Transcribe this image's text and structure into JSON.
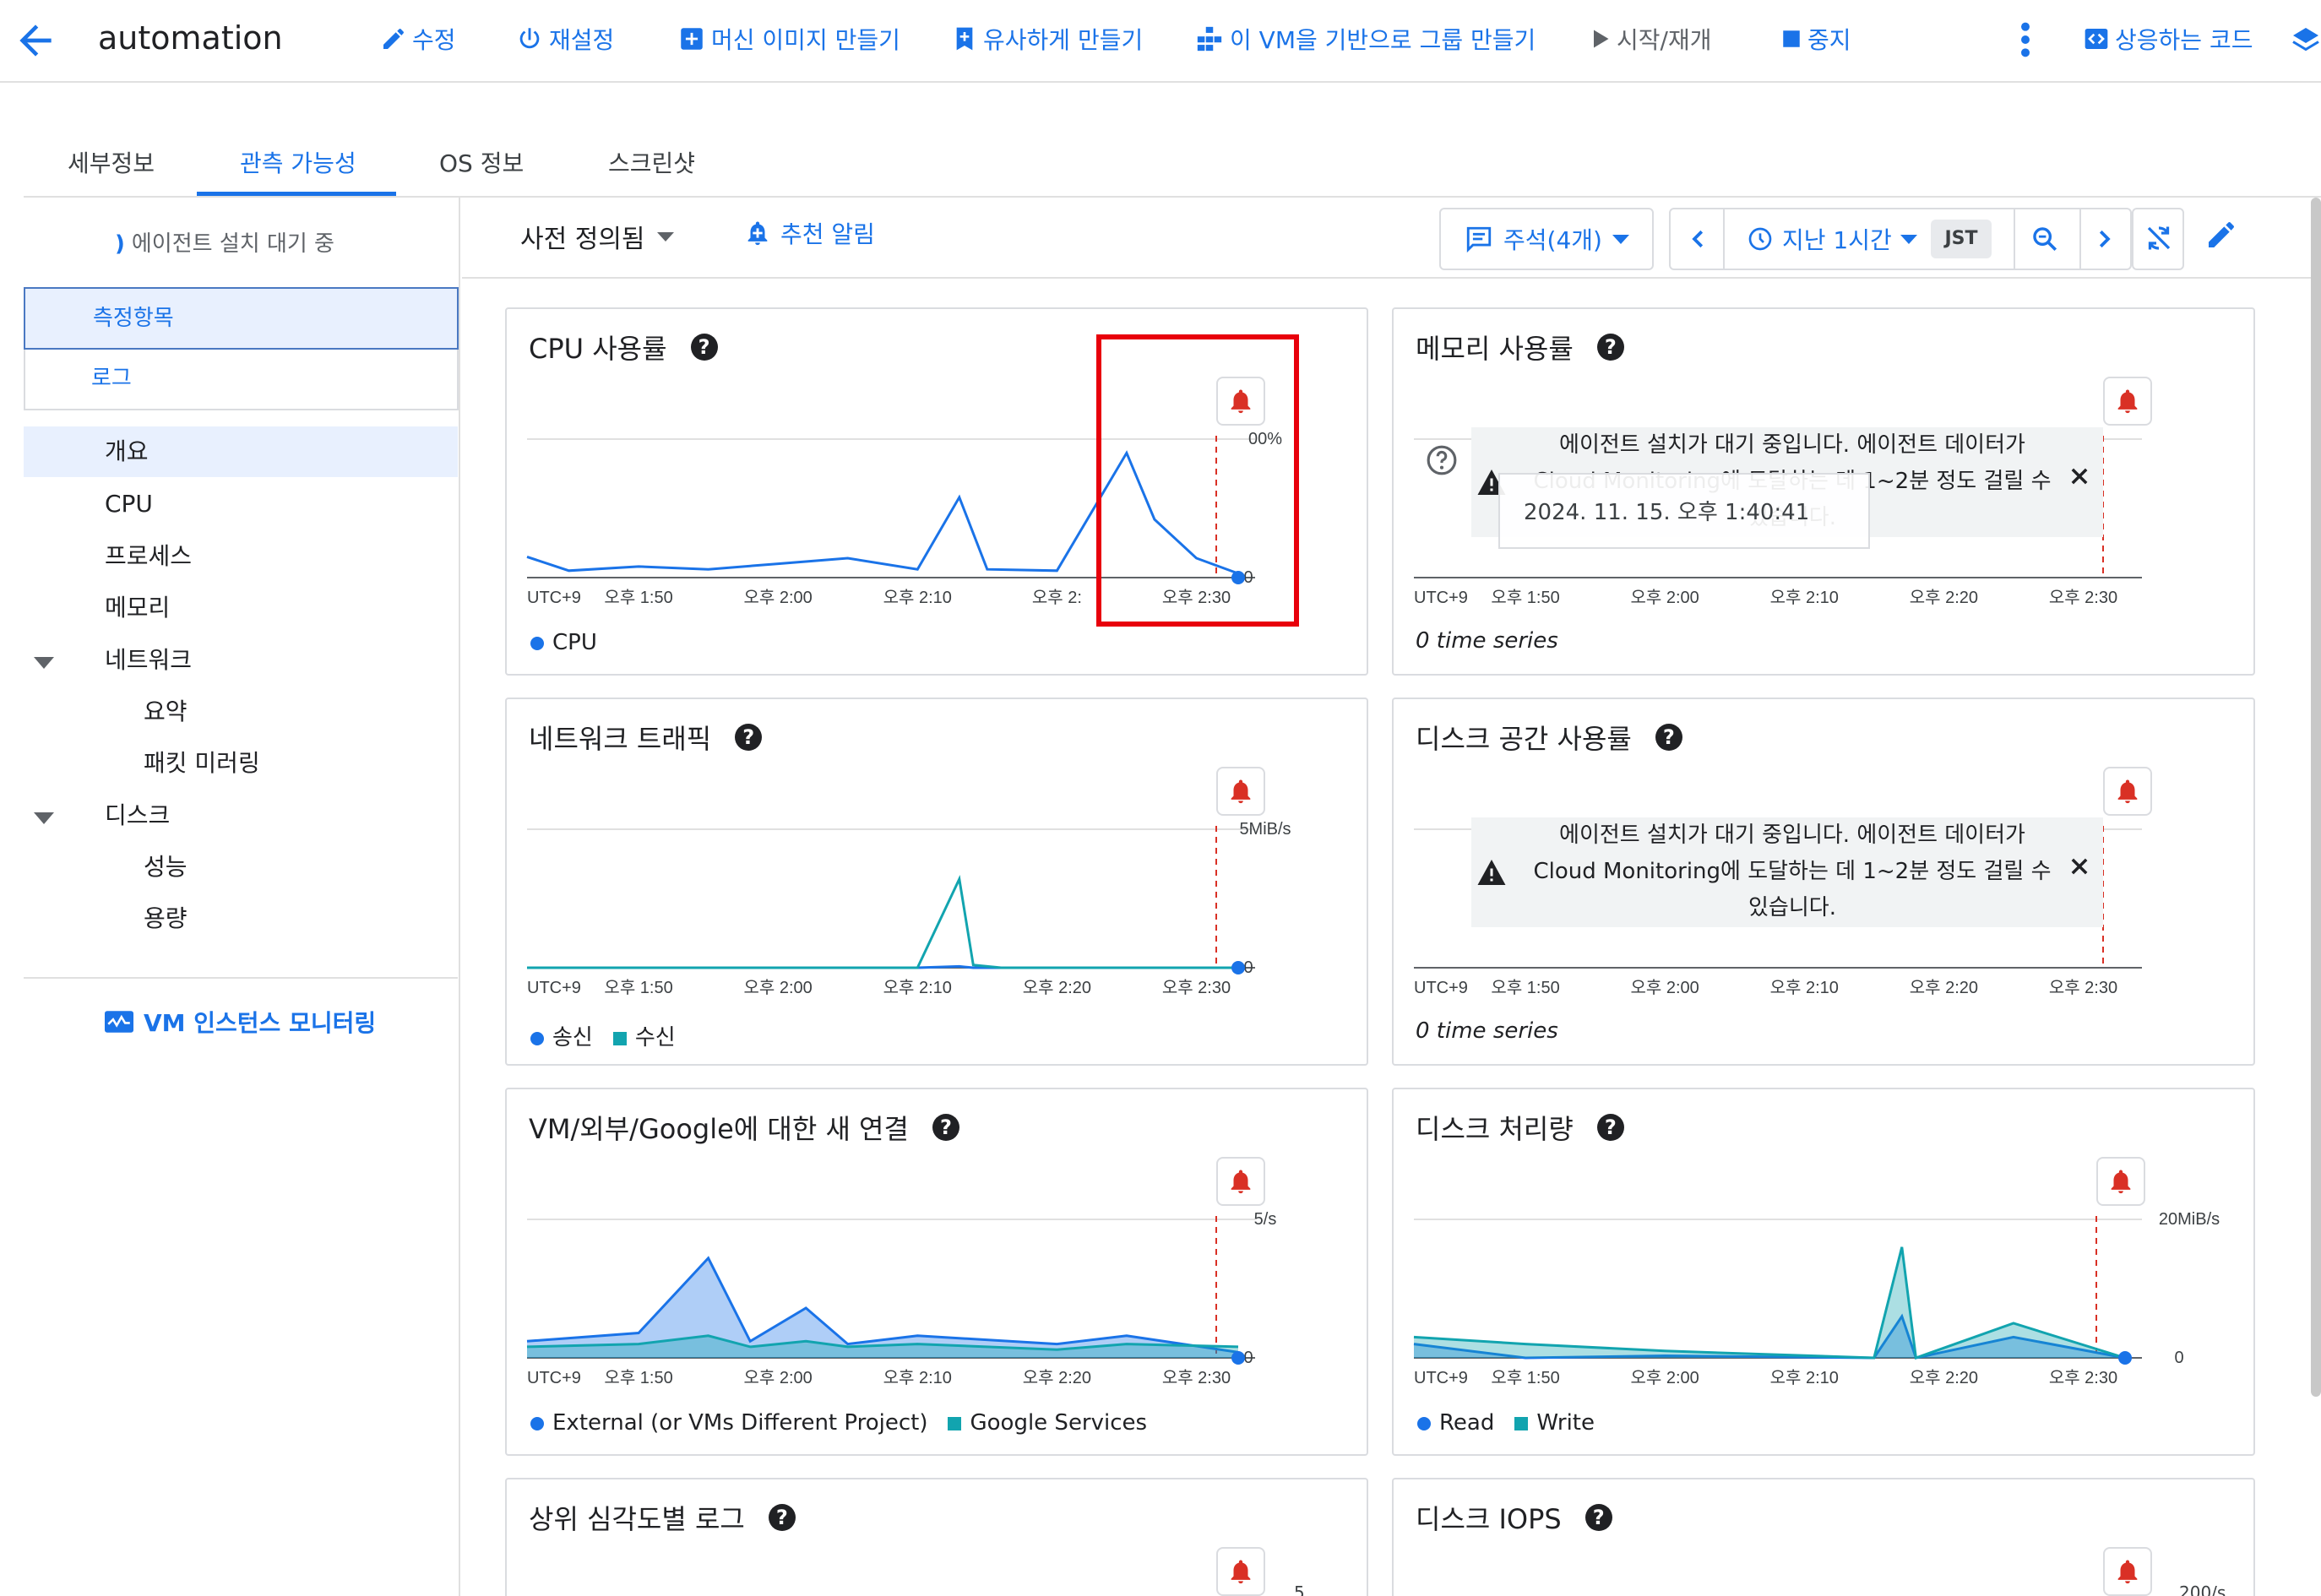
{
  "header": {
    "vm_name": "automation",
    "actions": [
      {
        "label": "수정",
        "icon": "pencil-icon"
      },
      {
        "label": "재설정",
        "icon": "power-icon"
      },
      {
        "label": "머신 이미지 만들기",
        "icon": "add-box-icon"
      },
      {
        "label": "유사하게 만들기",
        "icon": "add-bookmark-icon"
      },
      {
        "label": "이 VM을 기반으로 그룹 만들기",
        "icon": "group-icon"
      },
      {
        "label": "시작/재개",
        "icon": "play-icon"
      },
      {
        "label": "중지",
        "icon": "stop-icon"
      },
      {
        "label": "상응하는 코드",
        "icon": "code-icon"
      }
    ]
  },
  "tabs": [
    "세부정보",
    "관측 가능성",
    "OS 정보",
    "스크린샷"
  ],
  "sidebar": {
    "agent_status": "에이전트 설치 대기 중",
    "segments": {
      "metrics": "측정항목",
      "logs": "로그"
    },
    "nav": [
      "개요",
      "CPU",
      "프로세스",
      "메모리",
      "네트워크",
      "요약",
      "패킷 미러링",
      "디스크",
      "성능",
      "용량"
    ],
    "vm_monitoring": "VM 인스턴스 모니터링"
  },
  "toolbar": {
    "predefined": "사전 정의됨",
    "recommended_alerts": "추천 알림",
    "annotations": "주석(4개)",
    "time_range": "지난 1시간",
    "timezone": "JST"
  },
  "colors": {
    "accent": "#1a73e8",
    "teal": "#12a4af",
    "alert": "#d93025",
    "highlight": "#e8000b"
  },
  "x_axis": {
    "tz": "UTC+9",
    "ticks": [
      "오후 1:50",
      "오후 2:00",
      "오후 2:10",
      "오후 2:20",
      "오후 2:30"
    ],
    "cpu_ticks": [
      "오후 1:50",
      "오후 2:00",
      "오후 2:10",
      "오후 2:",
      "오후 2:30"
    ]
  },
  "cards": {
    "cpu": {
      "title": "CPU 사용률",
      "y_top": "00%",
      "y_zero": "0",
      "legend": [
        "CPU"
      ]
    },
    "memory": {
      "title": "메모리 사용률",
      "empty": "0 time series",
      "tooltip": "2024. 11. 15. 오후 1:40:41"
    },
    "network": {
      "title": "네트워크 트래픽",
      "y_top": "5MiB/s",
      "y_zero": "0",
      "legend": [
        "송신",
        "수신"
      ]
    },
    "disk_space": {
      "title": "디스크 공간 사용률",
      "empty": "0 time series"
    },
    "connections": {
      "title": "VM/외부/Google에 대한 새 연결",
      "y_top": "5/s",
      "y_zero": "0",
      "legend": [
        "External (or VMs Different Project)",
        "Google Services"
      ]
    },
    "disk_throughput": {
      "title": "디스크 처리량",
      "y_top": "20MiB/s",
      "y_zero": "0",
      "legend": [
        "Read",
        "Write"
      ]
    },
    "logs_severity": {
      "title": "상위 심각도별 로그",
      "y_top": "5"
    },
    "disk_iops": {
      "title": "디스크 IOPS",
      "y_top": "200/s"
    }
  },
  "banner": {
    "lines": [
      "에이전트 설치가 대기 중입니다. 에이전트 데이터가",
      "Cloud Monitoring에 도달하는 데 1~2분 정도 걸릴 수",
      "있습니다."
    ]
  },
  "chart_data": [
    {
      "type": "line",
      "title": "CPU 사용률",
      "x": [
        "오후 1:42",
        "오후 1:45",
        "오후 1:50",
        "오후 1:55",
        "오후 2:00",
        "오후 2:05",
        "오후 2:10",
        "오후 2:13",
        "오후 2:15",
        "오후 2:20",
        "오후 2:25",
        "오후 2:27",
        "오후 2:30",
        "오후 2:33"
      ],
      "series": [
        {
          "name": "CPU",
          "values": [
            15,
            5,
            8,
            6,
            10,
            14,
            6,
            58,
            6,
            5,
            90,
            42,
            14,
            3
          ]
        }
      ],
      "ylim": [
        0,
        100
      ]
    },
    {
      "type": "line",
      "title": "네트워크 트래픽",
      "x": [
        "오후 1:42",
        "오후 2:10",
        "오후 2:13",
        "오후 2:14",
        "오후 2:16",
        "오후 2:33"
      ],
      "series": [
        {
          "name": "송신",
          "values": [
            0,
            0,
            0.05,
            0,
            0,
            0
          ]
        },
        {
          "name": "수신",
          "values": [
            0,
            0,
            3.2,
            0.1,
            0,
            0
          ]
        }
      ],
      "ylim": [
        0,
        5
      ]
    },
    {
      "type": "area",
      "title": "VM/외부/Google에 대한 새 연결",
      "x": [
        "오후 1:42",
        "오후 1:50",
        "오후 1:55",
        "오후 1:58",
        "오후 2:02",
        "오후 2:05",
        "오후 2:10",
        "오후 2:20",
        "오후 2:25",
        "오후 2:33"
      ],
      "series": [
        {
          "name": "External (or VMs Different Project)",
          "values": [
            0.6,
            0.9,
            3.6,
            0.6,
            1.8,
            0.5,
            0.8,
            0.5,
            0.8,
            0.2
          ]
        },
        {
          "name": "Google Services",
          "values": [
            0.4,
            0.5,
            0.8,
            0.4,
            0.6,
            0.4,
            0.5,
            0.3,
            0.5,
            0.4
          ]
        }
      ],
      "ylim": [
        0,
        5
      ]
    },
    {
      "type": "area",
      "title": "디스크 처리량",
      "x": [
        "오후 1:42",
        "오후 1:50",
        "오후 2:00",
        "오후 2:15",
        "오후 2:17",
        "오후 2:18",
        "오후 2:25",
        "오후 2:33"
      ],
      "series": [
        {
          "name": "Read",
          "values": [
            2,
            0,
            0.3,
            0,
            6,
            0,
            3,
            0
          ]
        },
        {
          "name": "Write",
          "values": [
            3,
            2,
            1,
            0,
            16,
            0,
            5,
            0
          ]
        }
      ],
      "ylim": [
        0,
        20
      ]
    }
  ]
}
